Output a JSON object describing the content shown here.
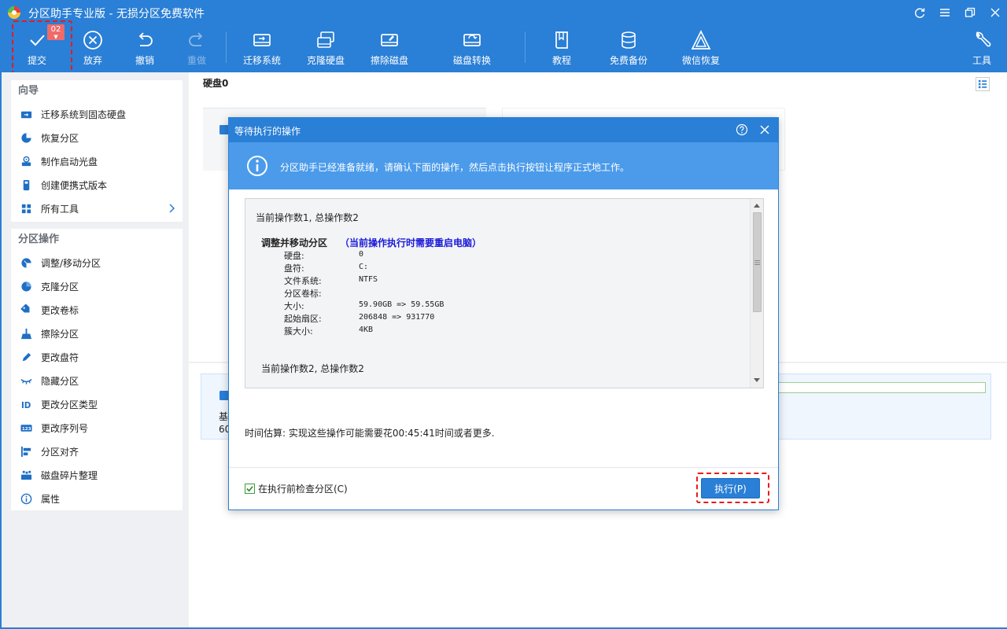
{
  "window": {
    "title": "分区助手专业版 - 无损分区免费软件",
    "controls": [
      "refresh-icon",
      "menu-icon",
      "restore-icon",
      "close-icon"
    ]
  },
  "toolbar": {
    "submit": {
      "label": "提交",
      "badge": "02"
    },
    "discard": "放弃",
    "undo": "撤销",
    "redo": "重做",
    "migrate": "迁移系统",
    "clone": "克隆硬盘",
    "wipe": "擦除磁盘",
    "convert": "磁盘转换",
    "tutorial": "教程",
    "backup": "免费备份",
    "wechat": "微信恢复",
    "tools": "工具"
  },
  "sidebar": {
    "wizard": {
      "title": "向导",
      "items": [
        {
          "label": "迁移系统到固态硬盘",
          "icon": "migrate-icon"
        },
        {
          "label": "恢复分区",
          "icon": "recover-icon"
        },
        {
          "label": "制作启动光盘",
          "icon": "bootdisk-icon"
        },
        {
          "label": "创建便携式版本",
          "icon": "portable-icon"
        },
        {
          "label": "所有工具",
          "icon": "grid-icon"
        }
      ]
    },
    "partition_ops": {
      "title": "分区操作",
      "items": [
        {
          "label": "调整/移动分区",
          "icon": "resize-icon"
        },
        {
          "label": "克隆分区",
          "icon": "clone-icon"
        },
        {
          "label": "更改卷标",
          "icon": "tag-icon"
        },
        {
          "label": "擦除分区",
          "icon": "broom-icon"
        },
        {
          "label": "更改盘符",
          "icon": "pencil-icon"
        },
        {
          "label": "隐藏分区",
          "icon": "eye-closed-icon"
        },
        {
          "label": "更改分区类型",
          "icon": "id-icon"
        },
        {
          "label": "更改序列号",
          "icon": "serial-icon"
        },
        {
          "label": "分区对齐",
          "icon": "align-icon"
        },
        {
          "label": "磁盘碎片整理",
          "icon": "defrag-icon"
        },
        {
          "label": "属性",
          "icon": "info-icon"
        }
      ]
    }
  },
  "main": {
    "disk_label": "硬盘0",
    "row2_line1": "基",
    "row2_line2": "60"
  },
  "dialog": {
    "title": "等待执行的操作",
    "info": "分区助手已经准备就绪，请确认下面的操作，然后点击执行按钮让程序正式地工作。",
    "op1_header": "当前操作数1, 总操作数2",
    "op1_title": "调整并移动分区",
    "op1_note": "（当前操作执行时需要重启电脑）",
    "op1_fields": [
      {
        "k": "硬盘:",
        "v": "0"
      },
      {
        "k": "盘符:",
        "v": "C:"
      },
      {
        "k": "文件系统:",
        "v": "NTFS"
      },
      {
        "k": "分区卷标:",
        "v": ""
      },
      {
        "k": "大小:",
        "v": "59.90GB => 59.55GB"
      },
      {
        "k": "起始扇区:",
        "v": "206848 => 931770"
      },
      {
        "k": "簇大小:",
        "v": "4KB"
      }
    ],
    "op2_header": "当前操作数2, 总操作数2",
    "eta": "时间估算: 实现这些操作可能需要花00:45:41时间或者更多.",
    "check_label": "在执行前检查分区(C)",
    "check_checked": true,
    "execute_label": "执行(P)"
  }
}
